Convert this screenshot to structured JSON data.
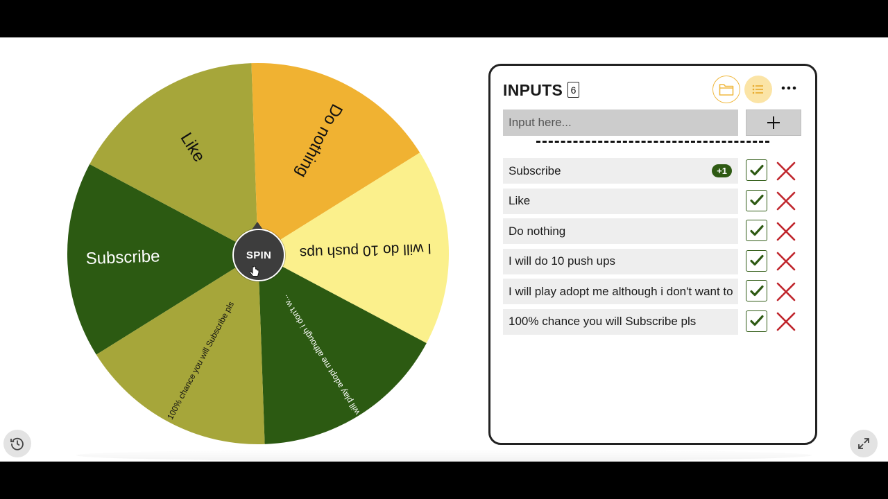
{
  "wheel": {
    "spin_label": "SPIN",
    "segments": [
      {
        "label": "Subscribe",
        "color": "#2c5a12",
        "text_color": "#ffffff"
      },
      {
        "label": "Like",
        "color": "#a6a63a",
        "text_color": "#111111"
      },
      {
        "label": "Do nothing",
        "color": "#f0b232",
        "text_color": "#111111"
      },
      {
        "label": "I will do 10 push ups",
        "color": "#fbf08c",
        "text_color": "#111111"
      },
      {
        "label": "I will play adopt me although i don't w...",
        "color": "#2c5a12",
        "text_color": "#ffffff"
      },
      {
        "label": "100% chance you will Subscribe pls",
        "color": "#a6a63a",
        "text_color": "#111111"
      }
    ]
  },
  "panel": {
    "title": "INPUTS",
    "count": "6",
    "input_placeholder": "Input here...",
    "divider": "----------------------------------------",
    "entries": [
      {
        "text": "Subscribe",
        "badge": "+1"
      },
      {
        "text": "Like"
      },
      {
        "text": "Do nothing"
      },
      {
        "text": "I will do 10 push ups"
      },
      {
        "text": "I will play adopt me although i don't want to"
      },
      {
        "text": "100% chance you will Subscribe pls"
      }
    ]
  },
  "icons": {
    "folder": "folder-icon",
    "list": "list-icon",
    "more": "more-icon",
    "add": "plus-icon",
    "check": "check-icon",
    "remove": "close-icon",
    "history": "history-icon",
    "expand": "expand-icon",
    "cursor": "hand-cursor-icon"
  },
  "colors": {
    "accent": "#f0b940",
    "check": "#2e5a13",
    "remove": "#c0262d"
  }
}
